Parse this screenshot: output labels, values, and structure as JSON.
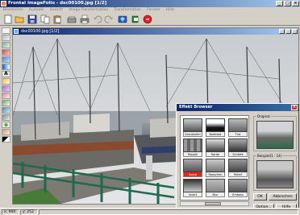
{
  "app": {
    "title": "Frontal ImageFolio - dsc00100.jpg [1/2]"
  },
  "menu": [
    "Bearbeiten",
    "Auswahl",
    "Ansicht",
    "Image-Transformation",
    "Transformation",
    "Fenster",
    "Hilfe"
  ],
  "toolbar": [
    "new-icon",
    "open-icon",
    "save-icon",
    "copy-icon",
    "paste-icon",
    "scan-icon",
    "print-icon",
    "undo-icon",
    "redo-icon",
    "filter-icon",
    "help-icon",
    "exit-icon"
  ],
  "document": {
    "title": "dsc00100.jpg [1/2]"
  },
  "effekt_browser": {
    "title": "Effekt Browser",
    "effects": [
      "Graustufen",
      "Kontrast",
      "Tint",
      "Mosaik",
      "Kante",
      "Schärfe",
      "Sepia",
      "Rauschen",
      "Relief",
      "Invert",
      "Blur",
      "Emboss"
    ],
    "selected_effect": "Sepia",
    "original_label": "Original",
    "preview_label": "Beispiel(1 : 14)",
    "ok_label": "OK",
    "cancel_label": "Abbrechen",
    "options_label": "Option...",
    "help_label": "Hilfe"
  },
  "status": {
    "x": "x: 900",
    "y": "y: 252"
  }
}
